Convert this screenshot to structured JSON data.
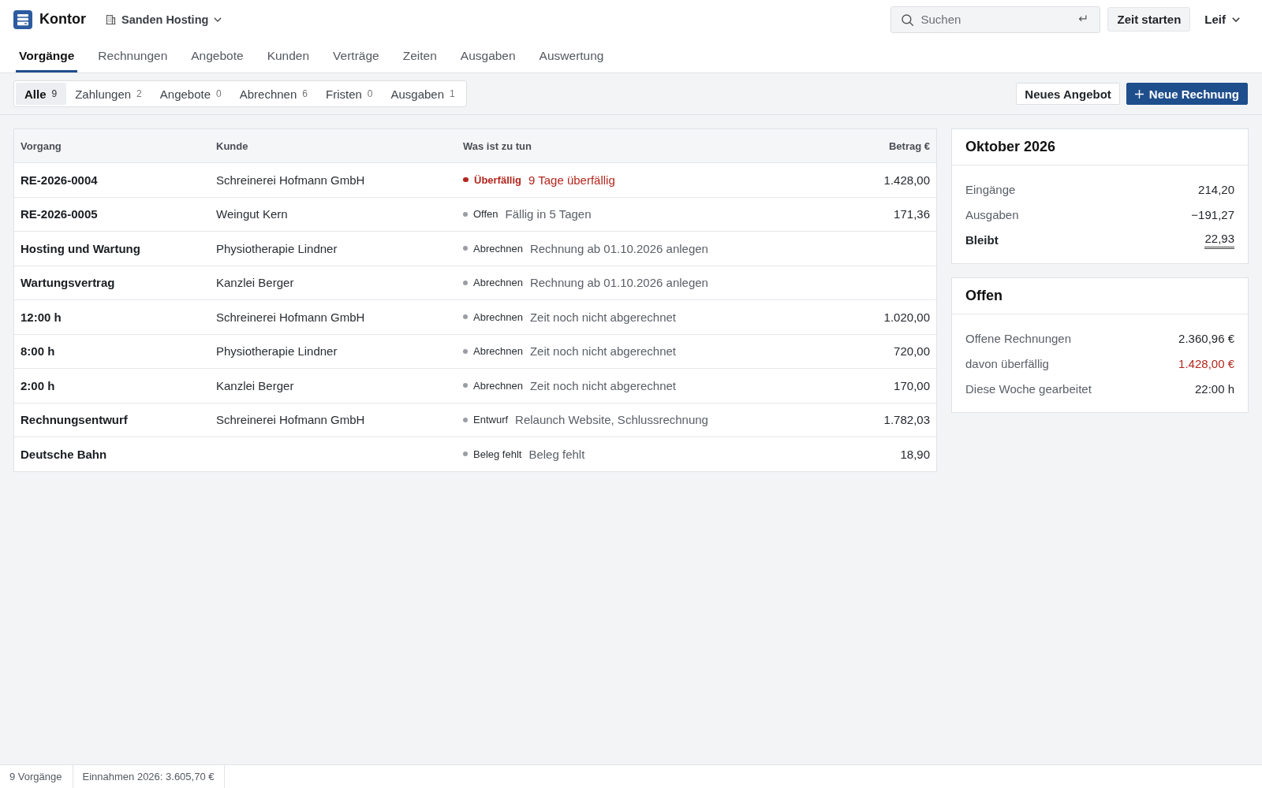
{
  "app": {
    "name": "Kontor",
    "workspace": "Sanden Hosting"
  },
  "search": {
    "placeholder": "Suchen"
  },
  "header_buttons": [
    {
      "label": "Zeit starten",
      "kind": "button"
    },
    {
      "label": "Leif",
      "kind": "menu"
    }
  ],
  "nav_tabs": [
    {
      "label": "Vorgänge",
      "selected": true
    },
    {
      "label": "Rechnungen",
      "selected": false
    },
    {
      "label": "Angebote",
      "selected": false
    },
    {
      "label": "Kunden",
      "selected": false
    },
    {
      "label": "Verträge",
      "selected": false
    },
    {
      "label": "Zeiten",
      "selected": false
    },
    {
      "label": "Ausgaben",
      "selected": false
    },
    {
      "label": "Auswertung",
      "selected": false
    }
  ],
  "filters": [
    {
      "label": "Alle",
      "count": "9",
      "selected": true
    },
    {
      "label": "Zahlungen",
      "count": "2",
      "selected": false
    },
    {
      "label": "Angebote",
      "count": "0",
      "selected": false
    },
    {
      "label": "Abrechnen",
      "count": "6",
      "selected": false
    },
    {
      "label": "Fristen",
      "count": "0",
      "selected": false
    },
    {
      "label": "Ausgaben",
      "count": "1",
      "selected": false
    }
  ],
  "actions": [
    {
      "label": "Neues Angebot",
      "kind": "secondary"
    },
    {
      "label": "Neue Rechnung",
      "kind": "primary"
    }
  ],
  "table": {
    "columns": [
      "Vorgang",
      "Kunde",
      "Was ist zu tun",
      "Betrag €"
    ],
    "rows": [
      {
        "reference": "RE-2026-0004",
        "customer": "Schreinerei Hofmann GmbH",
        "status": "Überfällig",
        "todo": "9 Tage überfällig",
        "amount": "1.428,00",
        "overdue": true
      },
      {
        "reference": "RE-2026-0005",
        "customer": "Weingut Kern",
        "status": "Offen",
        "todo": "Fällig in 5 Tagen",
        "amount": "171,36",
        "overdue": false
      },
      {
        "reference": "Hosting und Wartung",
        "customer": "Physiotherapie Lindner",
        "status": "Abrechnen",
        "todo": "Rechnung ab 01.10.2026 anlegen",
        "overdue": false
      },
      {
        "reference": "Wartungsvertrag",
        "customer": "Kanzlei Berger",
        "status": "Abrechnen",
        "todo": "Rechnung ab 01.10.2026 anlegen",
        "overdue": false
      },
      {
        "reference": "12:00 h",
        "customer": "Schreinerei Hofmann GmbH",
        "status": "Abrechnen",
        "todo": "Zeit noch nicht abgerechnet",
        "amount": "1.020,00",
        "overdue": false
      },
      {
        "reference": "8:00 h",
        "customer": "Physiotherapie Lindner",
        "status": "Abrechnen",
        "todo": "Zeit noch nicht abgerechnet",
        "amount": "720,00",
        "overdue": false
      },
      {
        "reference": "2:00 h",
        "customer": "Kanzlei Berger",
        "status": "Abrechnen",
        "todo": "Zeit noch nicht abgerechnet",
        "amount": "170,00",
        "overdue": false
      },
      {
        "reference": "Rechnungsentwurf",
        "customer": "Schreinerei Hofmann GmbH",
        "status": "Entwurf",
        "todo": "Relaunch Website, Schlussrechnung",
        "amount": "1.782,03",
        "overdue": false
      },
      {
        "reference": "Deutsche Bahn",
        "status": "Beleg fehlt",
        "todo": "Beleg fehlt",
        "amount": "18,90",
        "overdue": false
      }
    ]
  },
  "summary_cards": [
    {
      "title": "Oktober 2026",
      "rows": [
        {
          "label": "Eingänge",
          "value": "214,20",
          "kind": "normal"
        },
        {
          "label": "Ausgaben",
          "value": "−191,27",
          "kind": "normal"
        },
        {
          "label": "Bleibt",
          "value": "22,93",
          "kind": "total"
        }
      ]
    },
    {
      "title": "Offen",
      "rows": [
        {
          "label": "Offene Rechnungen",
          "value": "2.360,96 €",
          "kind": "normal"
        },
        {
          "label": "davon überfällig",
          "value": "1.428,00 €",
          "kind": "warning"
        },
        {
          "label": "Diese Woche gearbeitet",
          "value": "22:00 h",
          "kind": "normal"
        }
      ]
    }
  ],
  "status_bar": [
    "9 Vorgänge",
    "Einnahmen 2026: 3.605,70 €"
  ]
}
